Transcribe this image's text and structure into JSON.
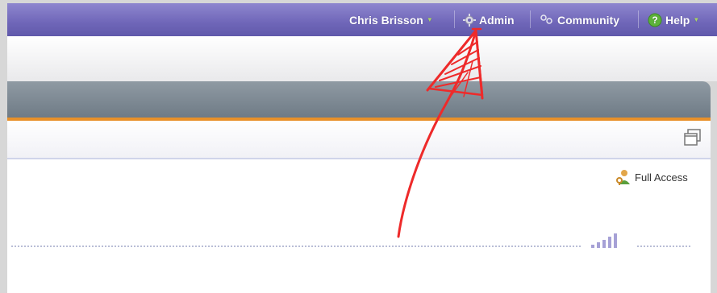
{
  "topnav": {
    "user_label": "Chris Brisson",
    "admin_label": "Admin",
    "community_label": "Community",
    "help_label": "Help"
  },
  "content": {
    "access_label": "Full Access"
  },
  "colors": {
    "nav_bg": "#6f66b8",
    "accent_line": "#e8902a",
    "panel_header": "#7b8792",
    "annotation": "#ee2a2a"
  },
  "icons": [
    "gear-icon",
    "community-icon",
    "help-icon",
    "caret-down-icon",
    "maximize-icon",
    "full-access-icon",
    "signal-icon"
  ]
}
